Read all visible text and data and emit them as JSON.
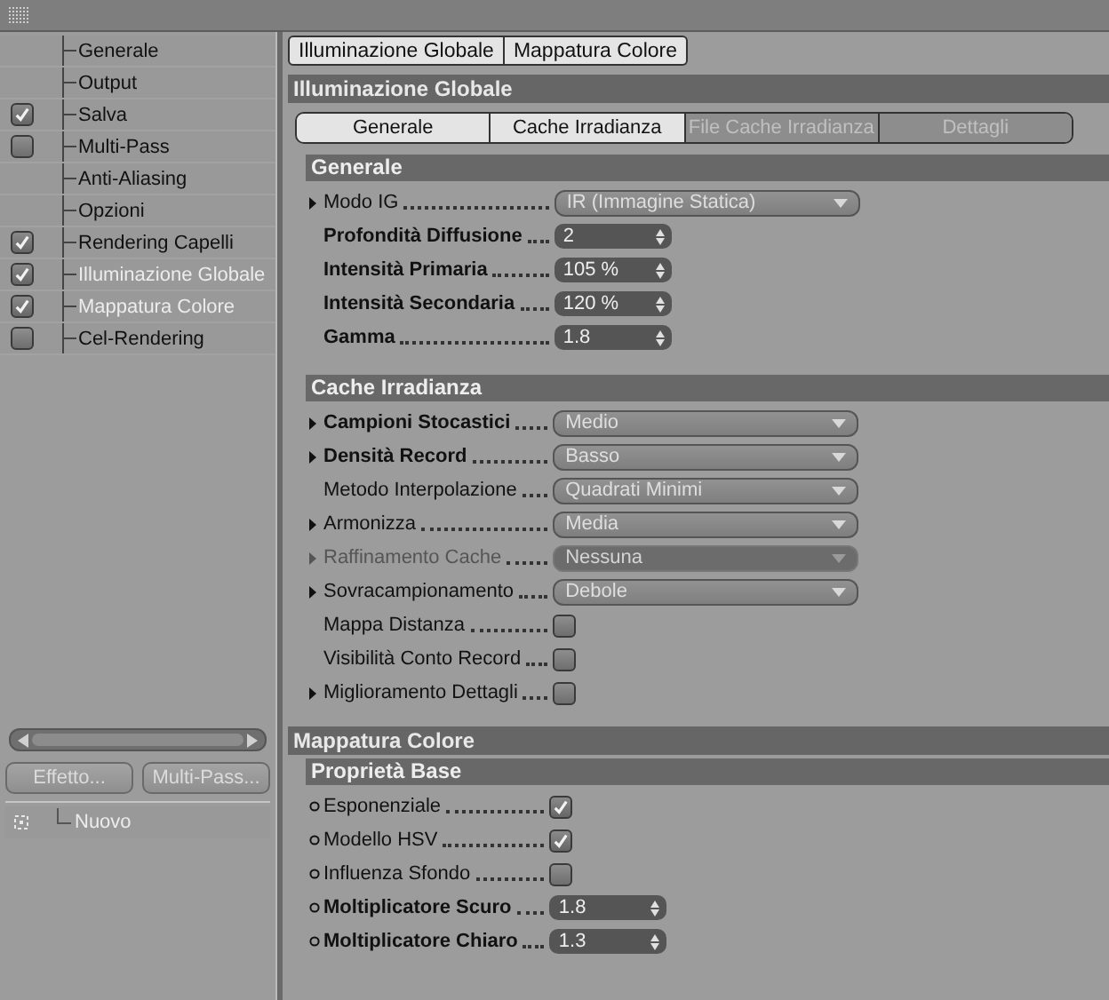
{
  "sidebar": {
    "items": [
      {
        "label": "Generale",
        "kind": "plain",
        "selected": false
      },
      {
        "label": "Output",
        "kind": "plain",
        "selected": false
      },
      {
        "label": "Salva",
        "kind": "checkbox",
        "checked": true,
        "selected": false
      },
      {
        "label": "Multi-Pass",
        "kind": "checkbox",
        "checked": false,
        "selected": false
      },
      {
        "label": "Anti-Aliasing",
        "kind": "plain",
        "selected": false
      },
      {
        "label": "Opzioni",
        "kind": "plain",
        "selected": false
      },
      {
        "label": "Rendering Capelli",
        "kind": "checkbox",
        "checked": true,
        "selected": false
      },
      {
        "label": "Illuminazione Globale",
        "kind": "checkbox",
        "checked": true,
        "selected": true
      },
      {
        "label": "Mappatura Colore",
        "kind": "checkbox",
        "checked": true,
        "selected": true
      },
      {
        "label": "Cel-Rendering",
        "kind": "checkbox",
        "checked": false,
        "selected": false
      }
    ]
  },
  "effect_buttons": [
    "Effetto...",
    "Multi-Pass..."
  ],
  "tree": [
    {
      "label": "Nuovo"
    }
  ],
  "top_tabs": [
    {
      "label": "Illuminazione Globale",
      "selected": true
    },
    {
      "label": "Mappatura Colore",
      "selected": true
    }
  ],
  "sections": [
    {
      "title": "Illuminazione Globale",
      "tabs": [
        {
          "label": "Generale",
          "selected": true
        },
        {
          "label": "Cache Irradianza",
          "selected": true
        },
        {
          "label": "File Cache Irradianza",
          "selected": false
        },
        {
          "label": "Dettagli",
          "selected": false
        }
      ],
      "groups": [
        {
          "title": "Generale",
          "rows": [
            {
              "label": "Modo IG",
              "kind": "dropdown",
              "value": "IR (Immagine Statica)",
              "expandable": true,
              "keyframe": false,
              "bold": false,
              "disabled": false
            },
            {
              "label": "Profondità Diffusione",
              "kind": "spinner",
              "value": "2",
              "expandable": false,
              "keyframe": false,
              "bold": true,
              "disabled": false
            },
            {
              "label": "Intensità Primaria",
              "kind": "spinner",
              "value": "105 %",
              "expandable": false,
              "keyframe": false,
              "bold": true,
              "disabled": false
            },
            {
              "label": "Intensità Secondaria",
              "kind": "spinner",
              "value": "120 %",
              "expandable": false,
              "keyframe": false,
              "bold": true,
              "disabled": false
            },
            {
              "label": "Gamma",
              "kind": "spinner",
              "value": "1.8",
              "expandable": false,
              "keyframe": false,
              "bold": true,
              "disabled": false
            }
          ]
        },
        {
          "title": "Cache Irradianza",
          "rows": [
            {
              "label": "Campioni Stocastici",
              "kind": "dropdown",
              "value": "Medio",
              "expandable": true,
              "keyframe": false,
              "bold": true,
              "disabled": false
            },
            {
              "label": "Densità Record",
              "kind": "dropdown",
              "value": "Basso",
              "expandable": true,
              "keyframe": false,
              "bold": true,
              "disabled": false
            },
            {
              "label": "Metodo Interpolazione",
              "kind": "dropdown",
              "value": "Quadrati Minimi",
              "expandable": false,
              "keyframe": false,
              "bold": false,
              "disabled": false
            },
            {
              "label": "Armonizza",
              "kind": "dropdown",
              "value": "Media",
              "expandable": true,
              "keyframe": false,
              "bold": false,
              "disabled": false
            },
            {
              "label": "Raffinamento Cache",
              "kind": "dropdown",
              "value": "Nessuna",
              "expandable": true,
              "keyframe": false,
              "bold": false,
              "disabled": true
            },
            {
              "label": "Sovracampionamento",
              "kind": "dropdown",
              "value": "Debole",
              "expandable": true,
              "keyframe": false,
              "bold": false,
              "disabled": false
            },
            {
              "label": "Mappa Distanza",
              "kind": "checkbox",
              "checked": false,
              "expandable": false,
              "keyframe": false,
              "bold": false,
              "disabled": false
            },
            {
              "label": "Visibilità Conto Record",
              "kind": "checkbox",
              "checked": false,
              "expandable": false,
              "keyframe": false,
              "bold": false,
              "disabled": false
            },
            {
              "label": "Miglioramento Dettagli",
              "kind": "checkbox",
              "checked": false,
              "expandable": true,
              "keyframe": false,
              "bold": false,
              "disabled": false
            }
          ]
        }
      ]
    },
    {
      "title": "Mappatura Colore",
      "groups": [
        {
          "title": "Proprietà Base",
          "rows": [
            {
              "label": "Esponenziale",
              "kind": "checkbox",
              "checked": true,
              "expandable": false,
              "keyframe": true,
              "bold": false,
              "disabled": false
            },
            {
              "label": "Modello HSV",
              "kind": "checkbox",
              "checked": true,
              "expandable": false,
              "keyframe": true,
              "bold": false,
              "disabled": false
            },
            {
              "label": "Influenza Sfondo",
              "kind": "checkbox",
              "checked": false,
              "expandable": false,
              "keyframe": true,
              "bold": false,
              "disabled": false
            },
            {
              "label": "Moltiplicatore Scuro",
              "kind": "spinner",
              "value": "1.8",
              "expandable": false,
              "keyframe": true,
              "bold": true,
              "disabled": false
            },
            {
              "label": "Moltiplicatore Chiaro",
              "kind": "spinner",
              "value": "1.3",
              "expandable": false,
              "keyframe": true,
              "bold": true,
              "disabled": false
            }
          ]
        }
      ]
    }
  ]
}
